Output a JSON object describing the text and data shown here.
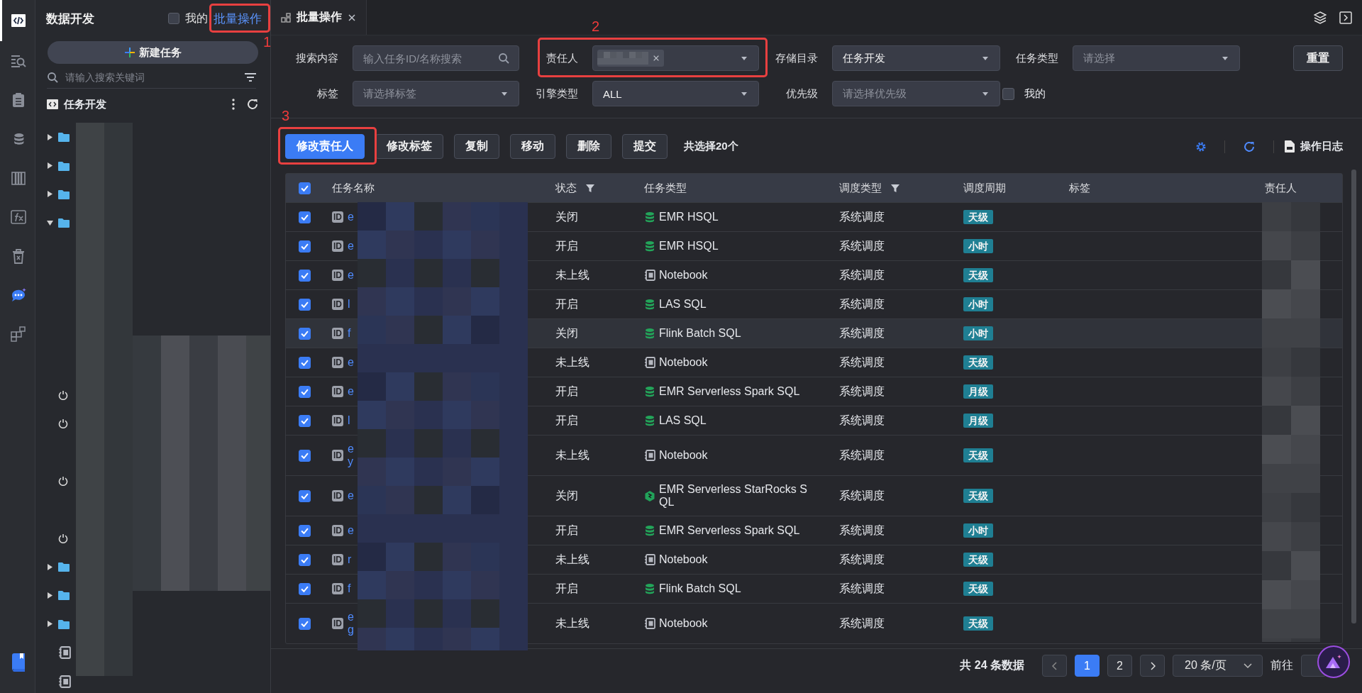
{
  "rail": {
    "items": [
      {
        "selected": true
      },
      {
        "selected": false
      },
      {
        "selected": false
      },
      {
        "selected": false
      },
      {
        "selected": false
      },
      {
        "selected": false
      },
      {
        "selected": false
      },
      {
        "selected": false
      },
      {
        "selected": false
      }
    ],
    "bottom": {
      "selected": false
    }
  },
  "sidebar": {
    "title": "数据开发",
    "mine": {
      "label": "我的",
      "checked": false
    },
    "batch_link": "批量操作",
    "new_button": "新建任务",
    "search": {
      "placeholder": "请输入搜索关键词"
    },
    "section": "任务开发",
    "tree": [
      {
        "kind": "folder",
        "expanded": false
      },
      {
        "kind": "folder",
        "expanded": false
      },
      {
        "kind": "folder",
        "expanded": false
      },
      {
        "kind": "folder",
        "expanded": true,
        "children": [
          {
            "kind": "task",
            "power": false
          },
          {
            "kind": "task",
            "power": false
          },
          {
            "kind": "task",
            "power": false
          },
          {
            "kind": "task",
            "power": false
          },
          {
            "kind": "task",
            "power": false
          },
          {
            "kind": "task",
            "power": true
          },
          {
            "kind": "task",
            "power": true
          },
          {
            "kind": "task",
            "power": false
          },
          {
            "kind": "task",
            "power": true
          },
          {
            "kind": "task",
            "power": false
          },
          {
            "kind": "task",
            "power": true
          }
        ]
      },
      {
        "kind": "folder",
        "expanded": false
      },
      {
        "kind": "folder",
        "expanded": false
      },
      {
        "kind": "folder",
        "expanded": false
      },
      {
        "kind": "notebook"
      },
      {
        "kind": "notebook"
      }
    ]
  },
  "tabs": [
    {
      "label": "批量操作",
      "selected": true
    }
  ],
  "filters": [
    {
      "label": "搜索内容",
      "kind": "search",
      "placeholder": "输入任务ID/名称搜索"
    },
    {
      "label": "责任人",
      "kind": "tags"
    },
    {
      "label": "存储目录",
      "kind": "select",
      "value": "任务开发"
    },
    {
      "label": "任务类型",
      "kind": "select",
      "placeholder": "请选择"
    },
    {
      "label": "标签",
      "kind": "select",
      "placeholder": "请选择标签"
    },
    {
      "label": "引擎类型",
      "kind": "select",
      "value": "ALL"
    },
    {
      "label": "优先级",
      "kind": "select",
      "placeholder": "请选择优先级"
    },
    {
      "label": "我的",
      "kind": "checkbox",
      "checked": false
    }
  ],
  "reset_button": "重置",
  "toolbar": {
    "buttons": [
      {
        "label": "修改责任人",
        "primary": true
      },
      {
        "label": "修改标签",
        "primary": false
      },
      {
        "label": "复制",
        "primary": false
      },
      {
        "label": "移动",
        "primary": false
      },
      {
        "label": "删除",
        "primary": false
      },
      {
        "label": "提交",
        "primary": false
      }
    ],
    "selection_count": "共选择20个",
    "log": "操作日志"
  },
  "table": {
    "all_checked": true,
    "columns": [
      {
        "label": "任务名称",
        "filter": false
      },
      {
        "label": "状态",
        "filter": true
      },
      {
        "label": "任务类型",
        "filter": false
      },
      {
        "label": "调度类型",
        "filter": true
      },
      {
        "label": "调度周期",
        "filter": false
      },
      {
        "label": "标签",
        "filter": false
      },
      {
        "label": "责任人",
        "filter": false
      }
    ],
    "rows": [
      {
        "checked": true,
        "tag": "ID",
        "name": "e",
        "status": "关闭",
        "kind": "hsql",
        "type": "EMR HSQL",
        "schedule": "系统调度",
        "period": "天级",
        "highlighted": false
      },
      {
        "checked": true,
        "tag": "ID",
        "name": "e",
        "status": "开启",
        "kind": "hsql",
        "type": "EMR HSQL",
        "schedule": "系统调度",
        "period": "小时",
        "highlighted": false
      },
      {
        "checked": true,
        "tag": "ID",
        "name": "e",
        "status": "未上线",
        "kind": "notebook",
        "type": "Notebook",
        "schedule": "系统调度",
        "period": "天级",
        "highlighted": false
      },
      {
        "checked": true,
        "tag": "ID",
        "name": "l",
        "status": "开启",
        "kind": "las",
        "type": "LAS SQL",
        "schedule": "系统调度",
        "period": "小时",
        "highlighted": false
      },
      {
        "checked": true,
        "tag": "ID",
        "name": "f",
        "status": "关闭",
        "kind": "flink",
        "type": "Flink Batch SQL",
        "schedule": "系统调度",
        "period": "小时",
        "highlighted": true
      },
      {
        "checked": true,
        "tag": "ID",
        "name": "e",
        "status": "未上线",
        "kind": "notebook",
        "type": "Notebook",
        "schedule": "系统调度",
        "period": "天级",
        "highlighted": false
      },
      {
        "checked": true,
        "tag": "ID",
        "name": "e",
        "status": "开启",
        "kind": "spark",
        "type": "EMR Serverless Spark SQL",
        "schedule": "系统调度",
        "period": "月级",
        "highlighted": false
      },
      {
        "checked": true,
        "tag": "ID",
        "name": "l",
        "status": "开启",
        "kind": "las",
        "type": "LAS SQL",
        "schedule": "系统调度",
        "period": "月级",
        "highlighted": false
      },
      {
        "checked": true,
        "tag": "ID",
        "name": "e\ny",
        "status": "未上线",
        "kind": "notebook",
        "type": "Notebook",
        "schedule": "系统调度",
        "period": "天级",
        "highlighted": false
      },
      {
        "checked": true,
        "tag": "ID",
        "name": "e",
        "status": "关闭",
        "kind": "starrocks",
        "type": "EMR Serverless StarRocks SQL",
        "schedule": "系统调度",
        "period": "天级",
        "highlighted": false
      },
      {
        "checked": true,
        "tag": "ID",
        "name": "e",
        "status": "开启",
        "kind": "spark",
        "type": "EMR Serverless Spark SQL",
        "schedule": "系统调度",
        "period": "小时",
        "highlighted": false
      },
      {
        "checked": true,
        "tag": "ID",
        "name": "r",
        "status": "未上线",
        "kind": "notebook",
        "type": "Notebook",
        "schedule": "系统调度",
        "period": "天级",
        "highlighted": false
      },
      {
        "checked": true,
        "tag": "ID",
        "name": "f",
        "status": "开启",
        "kind": "flink",
        "type": "Flink Batch SQL",
        "schedule": "系统调度",
        "period": "天级",
        "highlighted": false
      },
      {
        "checked": true,
        "tag": "ID",
        "name": "e\ng",
        "status": "未上线",
        "kind": "notebook",
        "type": "Notebook",
        "schedule": "系统调度",
        "period": "天级",
        "highlighted": false
      }
    ]
  },
  "pagination": {
    "total": "共 24 条数据",
    "pages": [
      {
        "label": "1",
        "selected": true
      },
      {
        "label": "2",
        "selected": false
      }
    ],
    "page_size": "20 条/页",
    "goto": "前往"
  },
  "annotations": [
    {
      "label": "1"
    },
    {
      "label": "2"
    },
    {
      "label": "3"
    }
  ]
}
